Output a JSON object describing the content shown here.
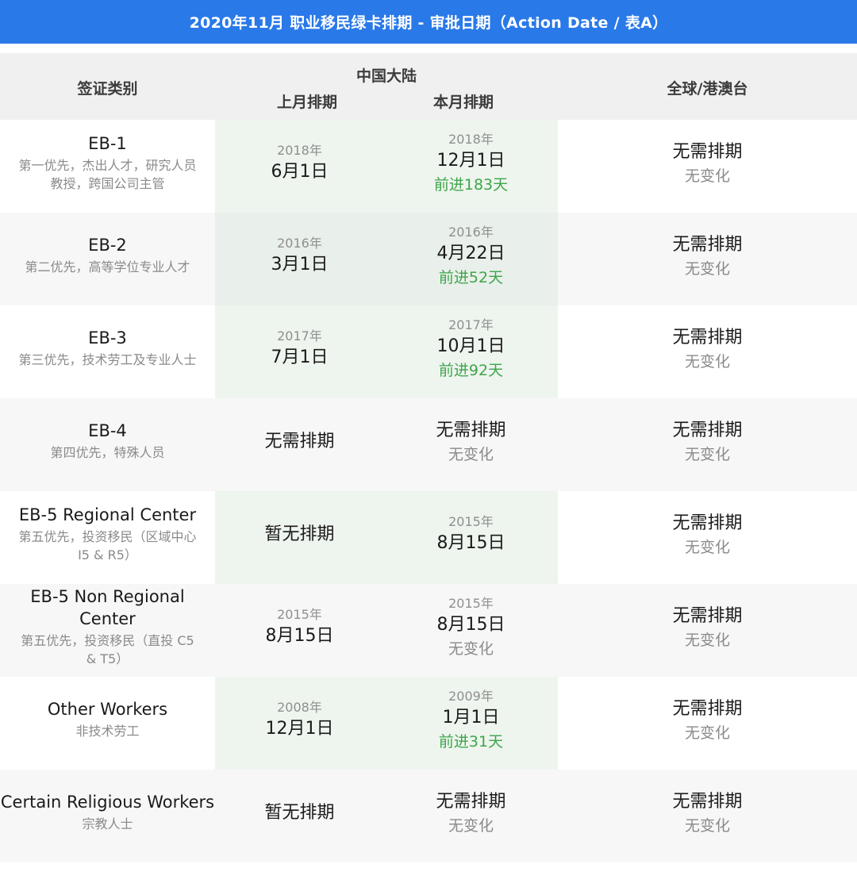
{
  "title": "2020年11月 职业移民绿卡排期 - 审批日期（Action Date / 表A）",
  "header": {
    "category": "签证类别",
    "china": "中国大陆",
    "prev_month": "上月排期",
    "curr_month": "本月排期",
    "global": "全球/港澳台"
  },
  "rows": [
    {
      "name": "EB-1",
      "desc": [
        "第一优先，杰出人才，研究人员",
        "教授，跨国公司主管"
      ],
      "prev": {
        "year": "2018年",
        "date": "6月1日"
      },
      "curr": {
        "year": "2018年",
        "date": "12月1日",
        "change": "前进183天"
      },
      "global": {
        "status": "无需排期",
        "change": "无变化"
      }
    },
    {
      "name": "EB-2",
      "desc": [
        "第二优先，高等学位专业人才"
      ],
      "prev": {
        "year": "2016年",
        "date": "3月1日"
      },
      "curr": {
        "year": "2016年",
        "date": "4月22日",
        "change": "前进52天"
      },
      "global": {
        "status": "无需排期",
        "change": "无变化"
      }
    },
    {
      "name": "EB-3",
      "desc": [
        "第三优先，技术劳工及专业人士"
      ],
      "prev": {
        "year": "2017年",
        "date": "7月1日"
      },
      "curr": {
        "year": "2017年",
        "date": "10月1日",
        "change": "前进92天"
      },
      "global": {
        "status": "无需排期",
        "change": "无变化"
      }
    },
    {
      "name": "EB-4",
      "desc": [
        "第四优先，特殊人员"
      ],
      "prev": {
        "status": "无需排期"
      },
      "curr": {
        "status": "无需排期",
        "change": "无变化"
      },
      "global": {
        "status": "无需排期",
        "change": "无变化"
      }
    },
    {
      "name": "EB-5 Regional Center",
      "desc": [
        "第五优先，投资移民（区域中心",
        "I5 & R5）"
      ],
      "prev": {
        "status": "暂无排期"
      },
      "curr": {
        "year": "2015年",
        "date": "8月15日"
      },
      "global": {
        "status": "无需排期",
        "change": "无变化"
      }
    },
    {
      "name": "EB-5 Non Regional Center",
      "name_lines": [
        "EB-5 Non Regional",
        "Center"
      ],
      "desc": [
        "第五优先，投资移民（直投 C5",
        "& T5）"
      ],
      "prev": {
        "year": "2015年",
        "date": "8月15日"
      },
      "curr": {
        "year": "2015年",
        "date": "8月15日",
        "change": "无变化"
      },
      "global": {
        "status": "无需排期",
        "change": "无变化"
      }
    },
    {
      "name": "Other Workers",
      "desc": [
        "非技术劳工"
      ],
      "prev": {
        "year": "2008年",
        "date": "12月1日"
      },
      "curr": {
        "year": "2009年",
        "date": "1月1日",
        "change": "前进31天"
      },
      "global": {
        "status": "无需排期",
        "change": "无变化"
      }
    },
    {
      "name": "Certain Religious Workers",
      "desc": [
        "宗教人士"
      ],
      "prev": {
        "status": "暂无排期"
      },
      "curr": {
        "status": "无需排期",
        "change": "无变化"
      },
      "global": {
        "status": "无需排期",
        "change": "无变化"
      }
    }
  ]
}
